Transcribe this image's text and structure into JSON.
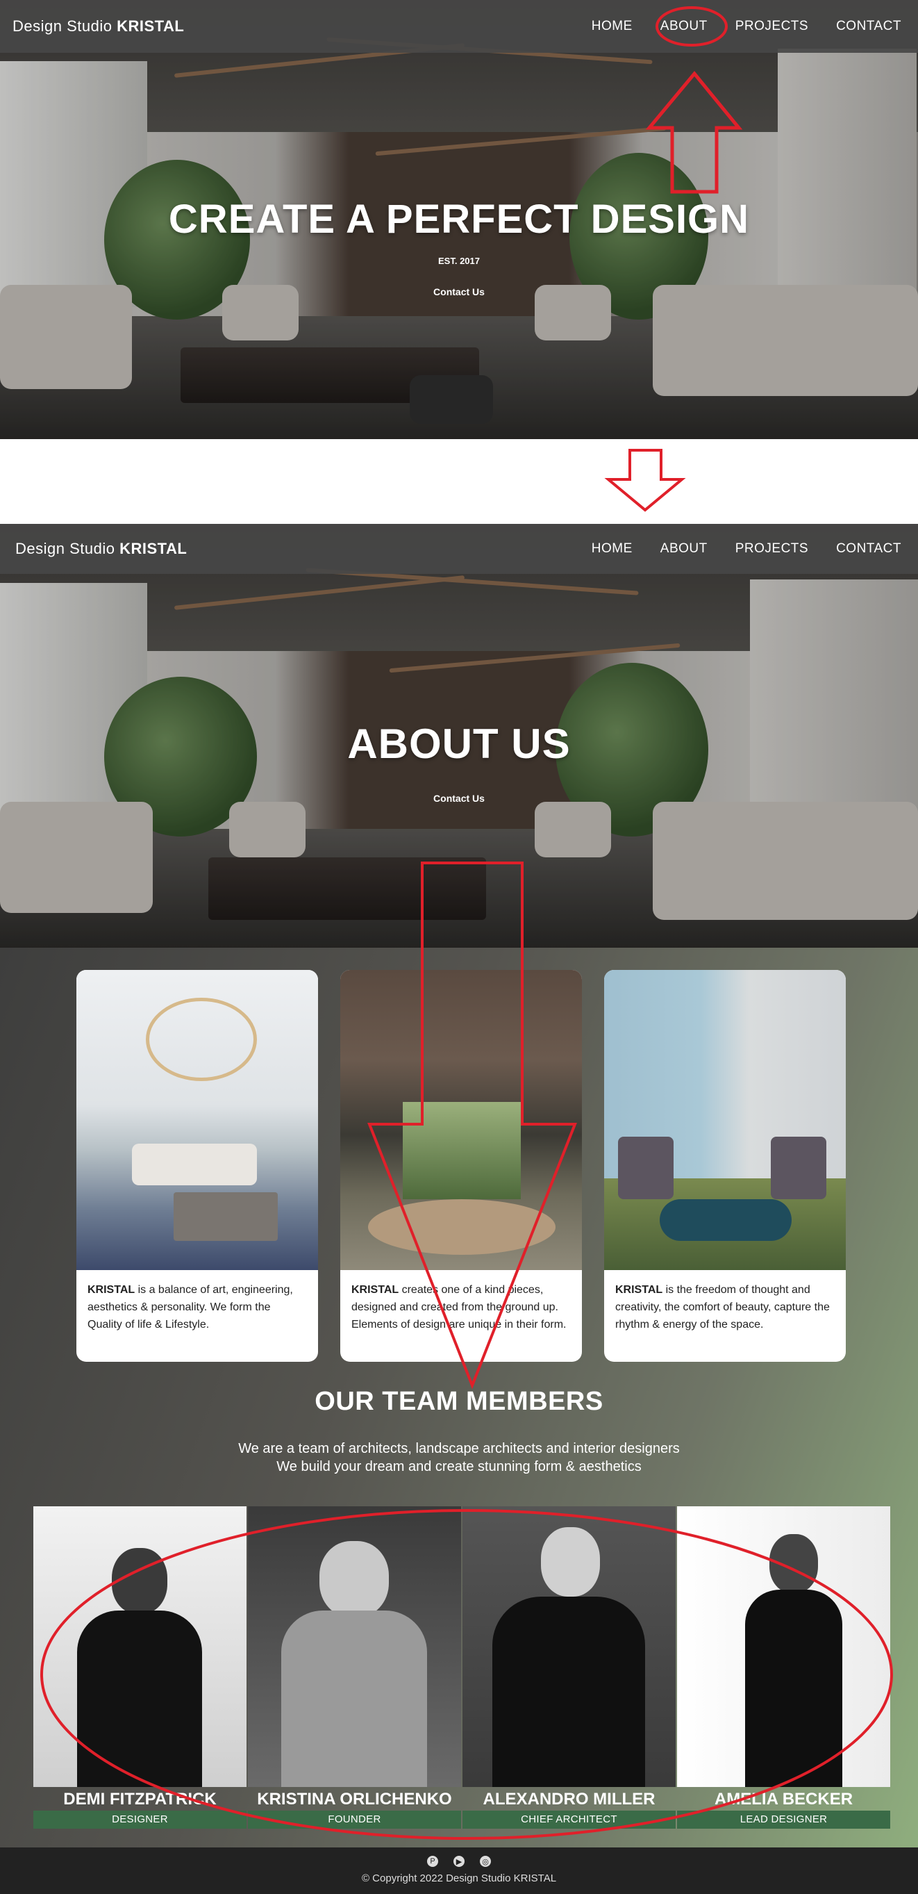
{
  "brand": {
    "prefix": "Design Studio ",
    "name": "KRISTAL"
  },
  "nav": {
    "home": "HOME",
    "about": "ABOUT",
    "projects": "PROJECTS",
    "contact": "CONTACT"
  },
  "hero_home": {
    "title": "CREATE A PERFECT DESIGN",
    "est": "EST. 2017",
    "link": "Contact Us"
  },
  "hero_about": {
    "title": "ABOUT US",
    "link": "Contact Us"
  },
  "cards": [
    {
      "brand": "KRISTAL",
      "text": " is a balance of art, engineering, aesthetics & personality. We form the Quality of life & Lifestyle."
    },
    {
      "brand": "KRISTAL",
      "text": " creates one of a kind pieces, designed and created from the ground up. Elements of design are unique in their form."
    },
    {
      "brand": "KRISTAL",
      "text": " is the freedom of thought and creativity, the comfort of beauty, capture the rhythm & energy of the space."
    }
  ],
  "team": {
    "title": "OUR TEAM MEMBERS",
    "desc_line1": "We are a team of architects, landscape architects and interior designers",
    "desc_line2": "We build your dream and create stunning form & aesthetics",
    "members": [
      {
        "name": "DEMI FITZPATRICK",
        "role": "DESIGNER"
      },
      {
        "name": "KRISTINA ORLICHENKO",
        "role": "FOUNDER"
      },
      {
        "name": "ALEXANDRO MILLER",
        "role": "CHIEF ARCHITECT"
      },
      {
        "name": "AMELIA BECKER",
        "role": "LEAD DESIGNER"
      }
    ]
  },
  "footer": {
    "icons": [
      "pinterest-icon",
      "youtube-icon",
      "instagram-icon"
    ],
    "copyright": "© Copyright 2022 Design Studio KRISTAL"
  },
  "colors": {
    "annotation": "#e0202a",
    "role_badge": "#3a6b47",
    "nav_bg": "#464646"
  }
}
